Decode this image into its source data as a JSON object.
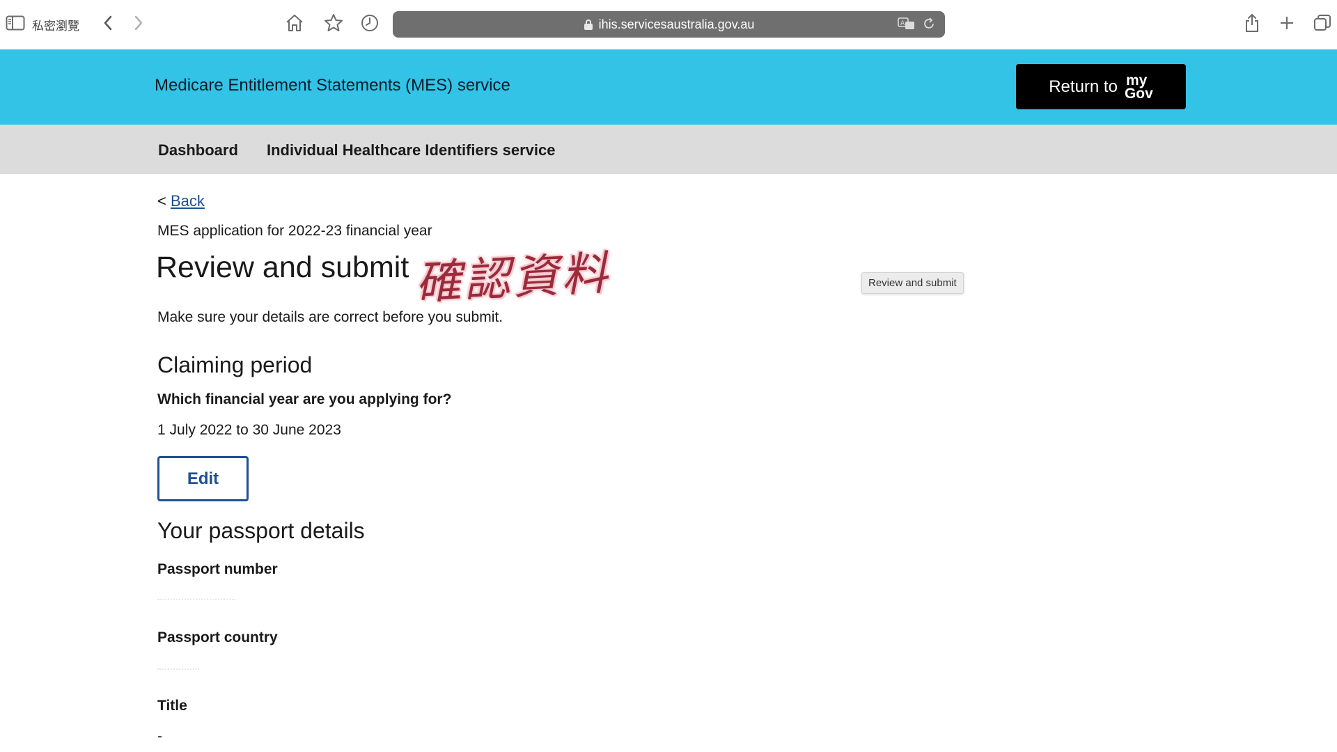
{
  "browser": {
    "private_label": "私密瀏覽",
    "url": "ihis.servicesaustralia.gov.au"
  },
  "header": {
    "service_title": "Medicare Entitlement Statements (MES) service",
    "return_label": "Return to",
    "mygov_top": "my",
    "mygov_bottom": "Gov",
    "brand_color": "#32c3e6"
  },
  "nav": {
    "items": [
      {
        "label": "Dashboard"
      },
      {
        "label": "Individual Healthcare Identifiers service"
      }
    ]
  },
  "main": {
    "back_prefix": "<",
    "back_label": "Back",
    "caption": "MES application for 2022-23 financial year",
    "title": "Review and submit",
    "sticker_text": "確認資料",
    "tooltip": "Review and submit",
    "intro": "Make sure your details are correct before you submit.",
    "claiming": {
      "heading": "Claiming period",
      "question": "Which financial year are you applying for?",
      "answer": "1 July 2022 to 30 June 2023",
      "edit_label": "Edit"
    },
    "passport": {
      "heading": "Your passport details",
      "number_label": "Passport number",
      "country_label": "Passport country",
      "title_label": "Title",
      "title_value": "-"
    }
  }
}
